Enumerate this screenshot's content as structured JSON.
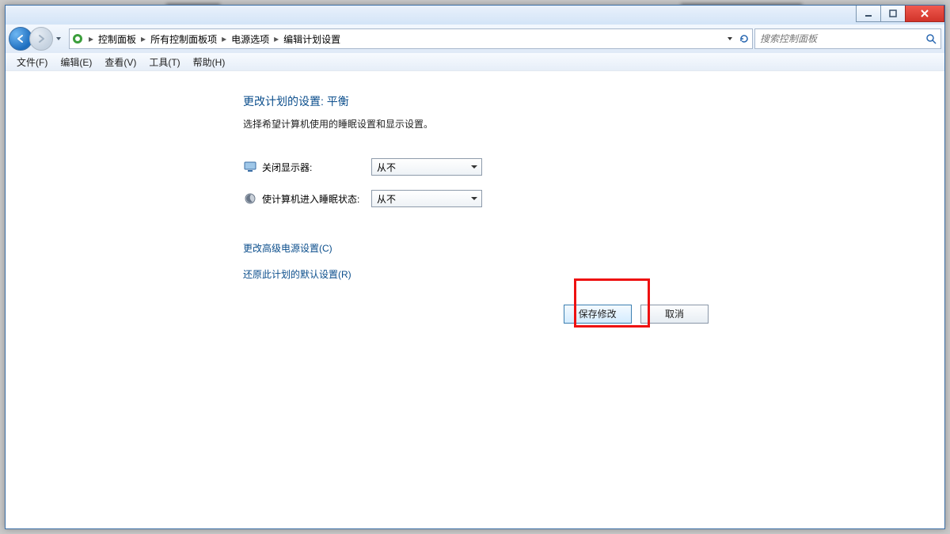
{
  "window": {
    "minimize_label": "Minimize",
    "maximize_label": "Maximize",
    "close_label": "Close"
  },
  "breadcrumb": {
    "items": [
      "控制面板",
      "所有控制面板项",
      "电源选项",
      "编辑计划设置"
    ]
  },
  "search": {
    "placeholder": "搜索控制面板"
  },
  "menu": {
    "items": [
      "文件(F)",
      "编辑(E)",
      "查看(V)",
      "工具(T)",
      "帮助(H)"
    ]
  },
  "page": {
    "title": "更改计划的设置: 平衡",
    "description": "选择希望计算机使用的睡眠设置和显示设置。",
    "rows": [
      {
        "label": "关闭显示器:",
        "value": "从不"
      },
      {
        "label": "使计算机进入睡眠状态:",
        "value": "从不"
      }
    ],
    "links": {
      "advanced": "更改高级电源设置(C)",
      "restore": "还原此计划的默认设置(R)"
    },
    "buttons": {
      "save": "保存修改",
      "cancel": "取消"
    }
  }
}
